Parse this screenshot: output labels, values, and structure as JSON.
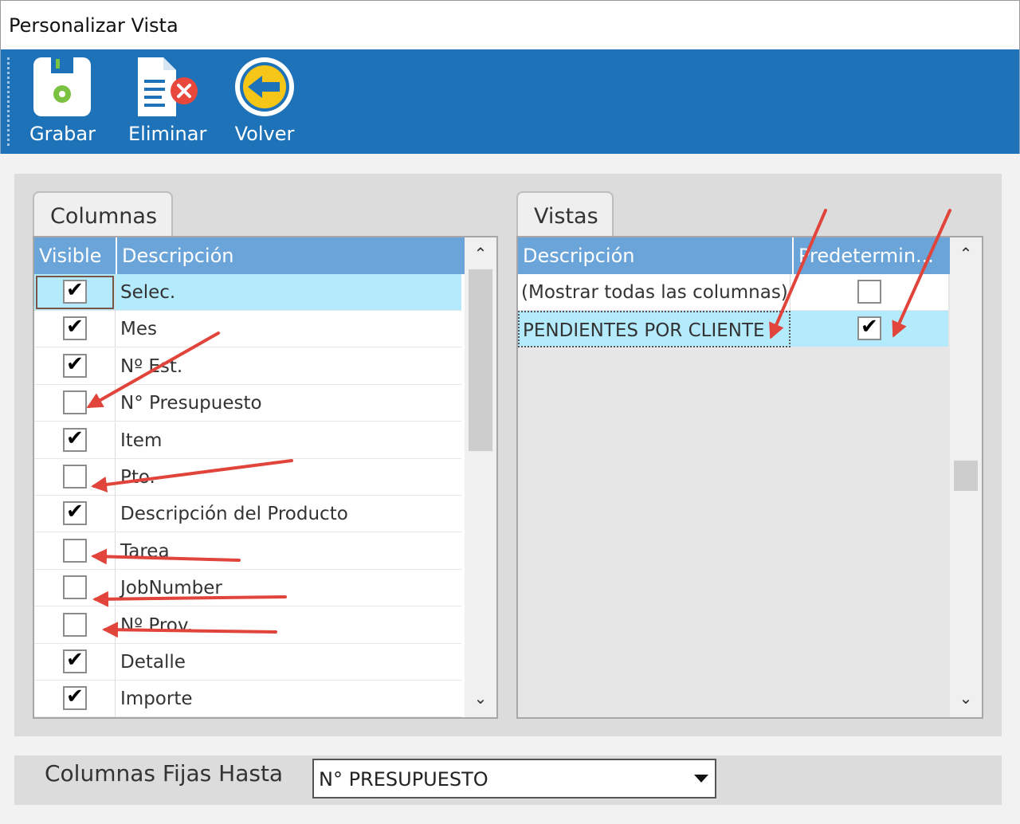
{
  "window": {
    "title": "Personalizar Vista"
  },
  "toolbar": {
    "save_label": "Grabar",
    "delete_label": "Eliminar",
    "back_label": "Volver"
  },
  "columns_panel": {
    "tab_label": "Columnas",
    "headers": {
      "visible": "Visible",
      "description": "Descripción"
    },
    "rows": [
      {
        "visible": true,
        "description": "Selec.",
        "selected": true
      },
      {
        "visible": true,
        "description": "Mes"
      },
      {
        "visible": true,
        "description": "Nº Est."
      },
      {
        "visible": false,
        "description": "N° Presupuesto"
      },
      {
        "visible": true,
        "description": "Item"
      },
      {
        "visible": false,
        "description": "Pto."
      },
      {
        "visible": true,
        "description": "Descripción del Producto"
      },
      {
        "visible": false,
        "description": "Tarea"
      },
      {
        "visible": false,
        "description": "JobNumber"
      },
      {
        "visible": false,
        "description": "Nº Prov."
      },
      {
        "visible": true,
        "description": "Detalle"
      },
      {
        "visible": true,
        "description": "Importe"
      }
    ]
  },
  "views_panel": {
    "tab_label": "Vistas",
    "headers": {
      "description": "Descripción",
      "default": "Predetermin..."
    },
    "rows": [
      {
        "description": "(Mostrar todas las columnas)",
        "default": false
      },
      {
        "description": "PENDIENTES POR CLIENTE",
        "default": true,
        "selected": true
      }
    ]
  },
  "fixed_columns": {
    "label": "Columnas Fijas Hasta",
    "value": "N° PRESUPUESTO"
  },
  "colors": {
    "toolbar_bg": "#1d72b8",
    "grid_header_bg": "#6ba4d8",
    "selected_row_bg": "#b3eafc",
    "annotation_arrow": "#e0443a"
  }
}
